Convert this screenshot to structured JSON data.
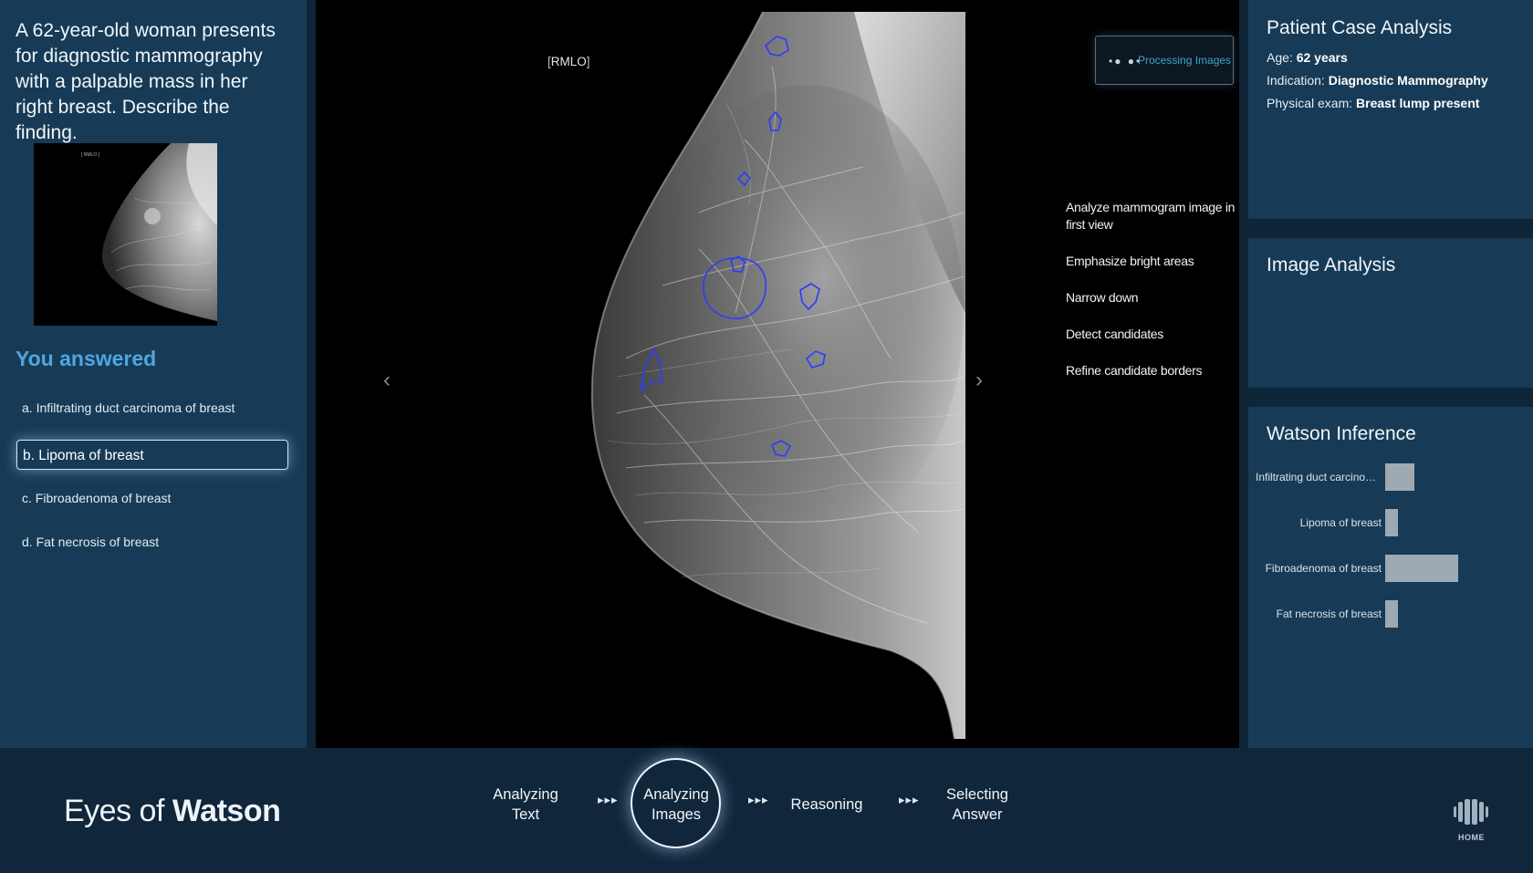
{
  "question": {
    "text": "A 62-year-old woman presents for diagnostic mammography with a palpable mass in her right breast. Describe the finding."
  },
  "answers": {
    "heading": "You answered",
    "options": [
      {
        "label": "a. Infiltrating duct carcinoma of breast",
        "selected": false
      },
      {
        "label": "b. Lipoma of breast",
        "selected": true
      },
      {
        "label": "c. Fibroadenoma of breast",
        "selected": false
      },
      {
        "label": "d. Fat necrosis of breast",
        "selected": false
      }
    ]
  },
  "viewer": {
    "view_label": "RMLO",
    "prev_icon": "chevron-left-icon",
    "next_icon": "chevron-right-icon",
    "processing": {
      "dots": "•● ●•",
      "label": "Processing Images"
    },
    "steps": [
      "Analyze mammogram image in first view",
      "Emphasize bright areas",
      "Narrow down",
      "Detect candidates",
      "Refine candidate borders"
    ],
    "highlight_color": "#2b3cff"
  },
  "patient": {
    "title": "Patient Case Analysis",
    "age_label": "Age:",
    "age_value": "62 years",
    "indication_label": "Indication:",
    "indication_value": "Diagnostic Mammography",
    "exam_label": "Physical exam:",
    "exam_value": "Breast lump present"
  },
  "image_analysis": {
    "title": "Image Analysis"
  },
  "inference": {
    "title": "Watson Inference",
    "bars": [
      {
        "label": "Infiltrating duct carcinoma of breast",
        "value": 0.4
      },
      {
        "label": "Lipoma of breast",
        "value": 0.18
      },
      {
        "label": "Fibroadenoma of breast",
        "value": 1.0
      },
      {
        "label": "Fat necrosis of breast",
        "value": 0.18
      }
    ]
  },
  "footer": {
    "brand_light": "Eyes of ",
    "brand_bold": "Watson",
    "stages": [
      {
        "line1": "Analyzing",
        "line2": "Text",
        "active": false
      },
      {
        "line1": "Analyzing",
        "line2": "Images",
        "active": true
      },
      {
        "line1": "Reasoning",
        "line2": "",
        "active": false
      },
      {
        "line1": "Selecting",
        "line2": "Answer",
        "active": false
      }
    ],
    "chevrons": "▸▸▸",
    "home_label": "HOME",
    "home_icon": "watson-home-icon"
  },
  "colors": {
    "panel": "#173b56",
    "accent": "#4fa6e0",
    "processing_text": "#3ea7c9"
  }
}
